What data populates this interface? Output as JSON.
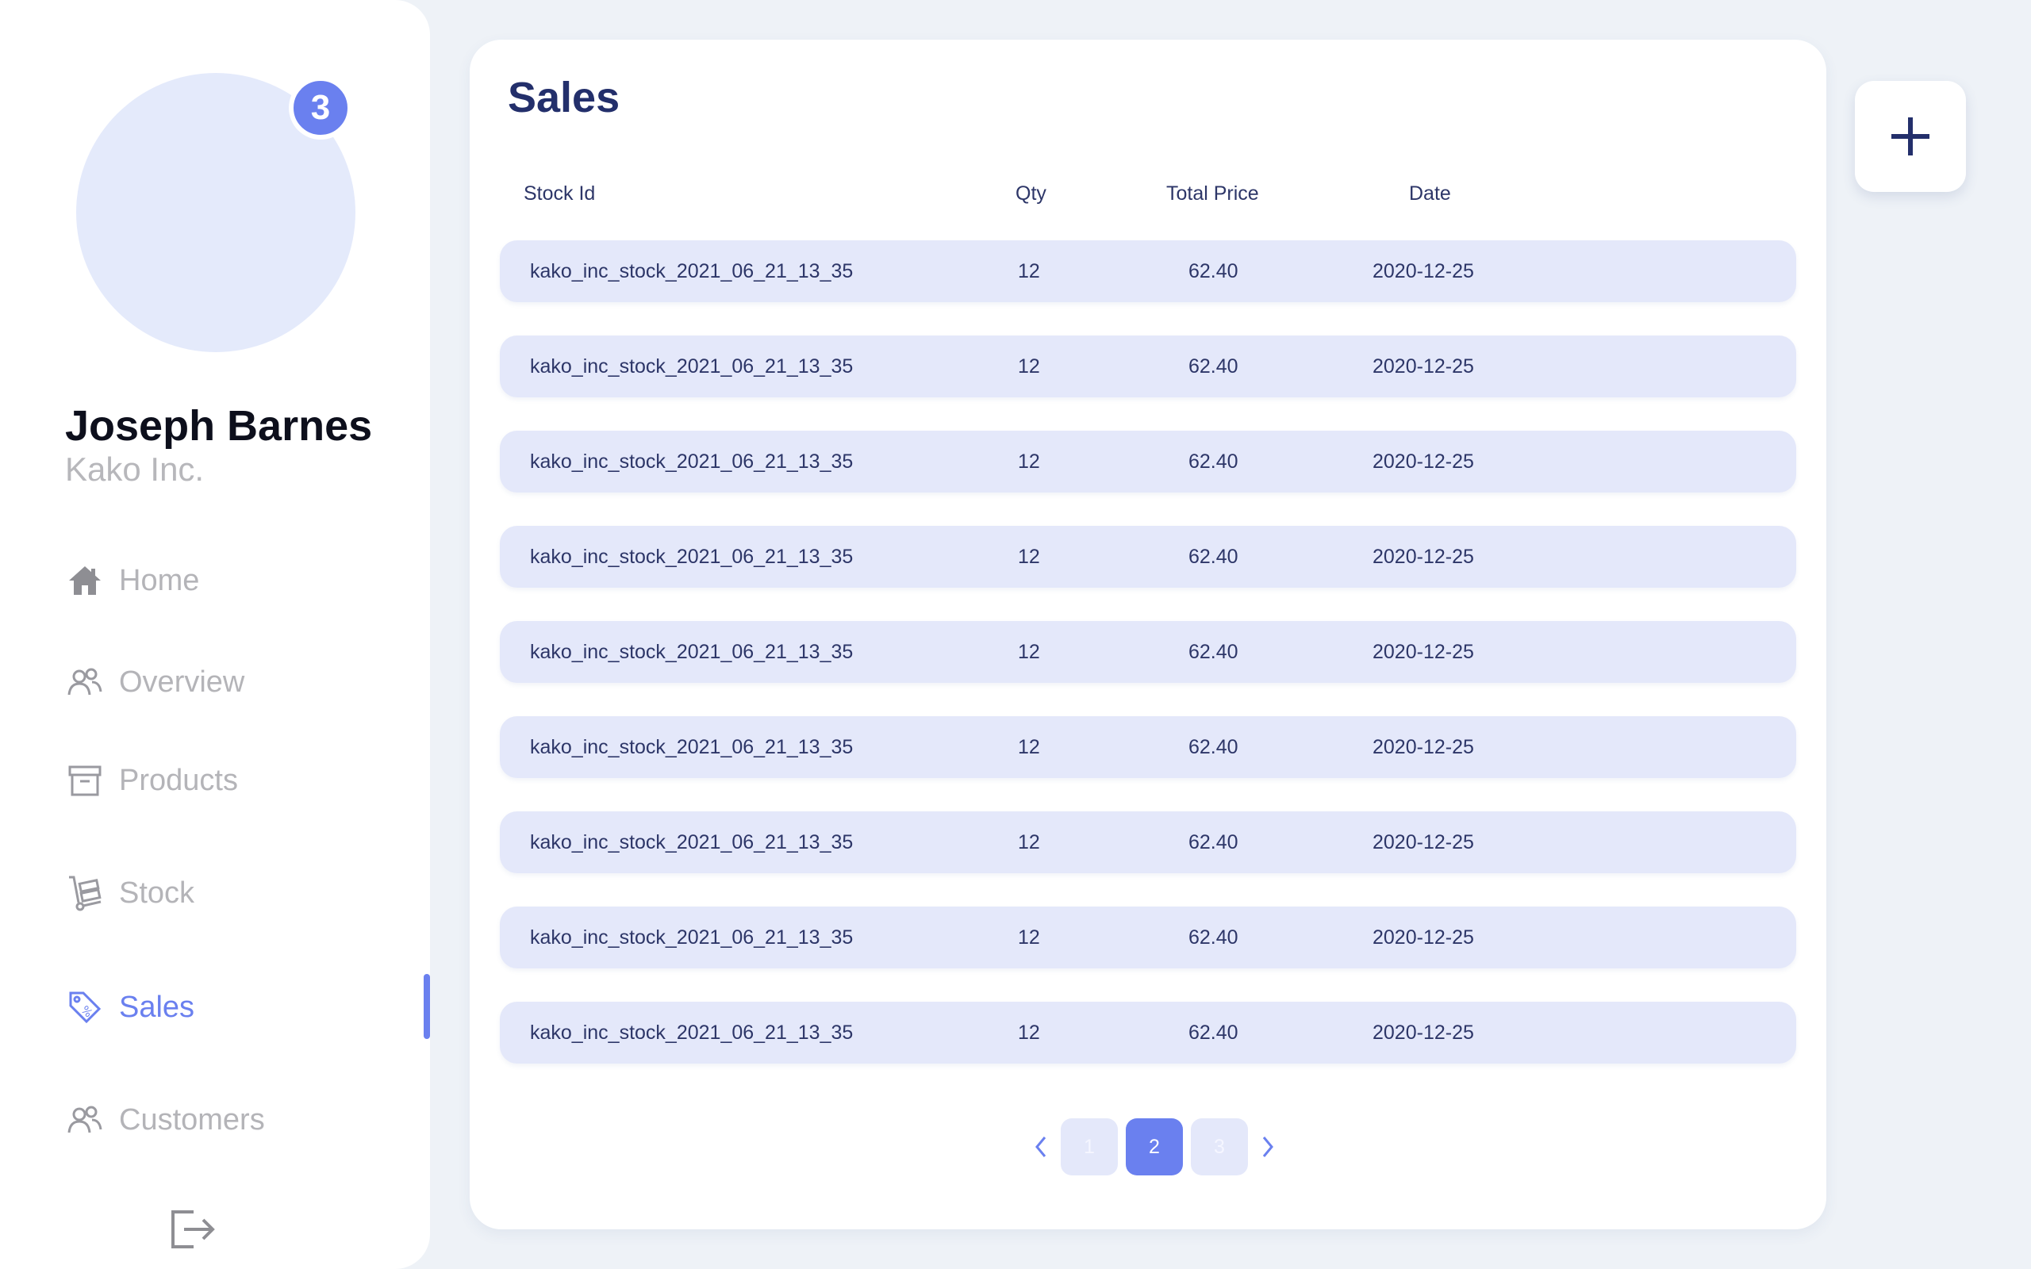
{
  "user": {
    "name": "Joseph Barnes",
    "company": "Kako Inc.",
    "notification_count": "3"
  },
  "nav": [
    {
      "label": "Home",
      "icon": "home-icon",
      "active": false
    },
    {
      "label": "Overview",
      "icon": "users-icon",
      "active": false
    },
    {
      "label": "Products",
      "icon": "archive-box-icon",
      "active": false
    },
    {
      "label": "Stock",
      "icon": "hand-truck-icon",
      "active": false
    },
    {
      "label": "Sales",
      "icon": "price-tag-icon",
      "active": true
    },
    {
      "label": "Customers",
      "icon": "users-icon",
      "active": false
    }
  ],
  "page": {
    "title": "Sales"
  },
  "table": {
    "columns": [
      "Stock Id",
      "Qty",
      "Total Price",
      "Date"
    ],
    "rows": [
      [
        "kako_inc_stock_2021_06_21_13_35",
        "12",
        "62.40",
        "2020-12-25"
      ],
      [
        "kako_inc_stock_2021_06_21_13_35",
        "12",
        "62.40",
        "2020-12-25"
      ],
      [
        "kako_inc_stock_2021_06_21_13_35",
        "12",
        "62.40",
        "2020-12-25"
      ],
      [
        "kako_inc_stock_2021_06_21_13_35",
        "12",
        "62.40",
        "2020-12-25"
      ],
      [
        "kako_inc_stock_2021_06_21_13_35",
        "12",
        "62.40",
        "2020-12-25"
      ],
      [
        "kako_inc_stock_2021_06_21_13_35",
        "12",
        "62.40",
        "2020-12-25"
      ],
      [
        "kako_inc_stock_2021_06_21_13_35",
        "12",
        "62.40",
        "2020-12-25"
      ],
      [
        "kako_inc_stock_2021_06_21_13_35",
        "12",
        "62.40",
        "2020-12-25"
      ],
      [
        "kako_inc_stock_2021_06_21_13_35",
        "12",
        "62.40",
        "2020-12-25"
      ]
    ]
  },
  "pagination": {
    "pages": [
      "1",
      "2",
      "3"
    ],
    "current": "2"
  },
  "colors": {
    "accent": "#6a80ef",
    "title": "#232f6b",
    "row_bg": "#e4e8fa",
    "muted": "#b4b4b8"
  },
  "icons": {
    "add": "plus-icon",
    "logout": "logout-icon",
    "prev": "chevron-left-icon",
    "next": "chevron-right-icon"
  }
}
